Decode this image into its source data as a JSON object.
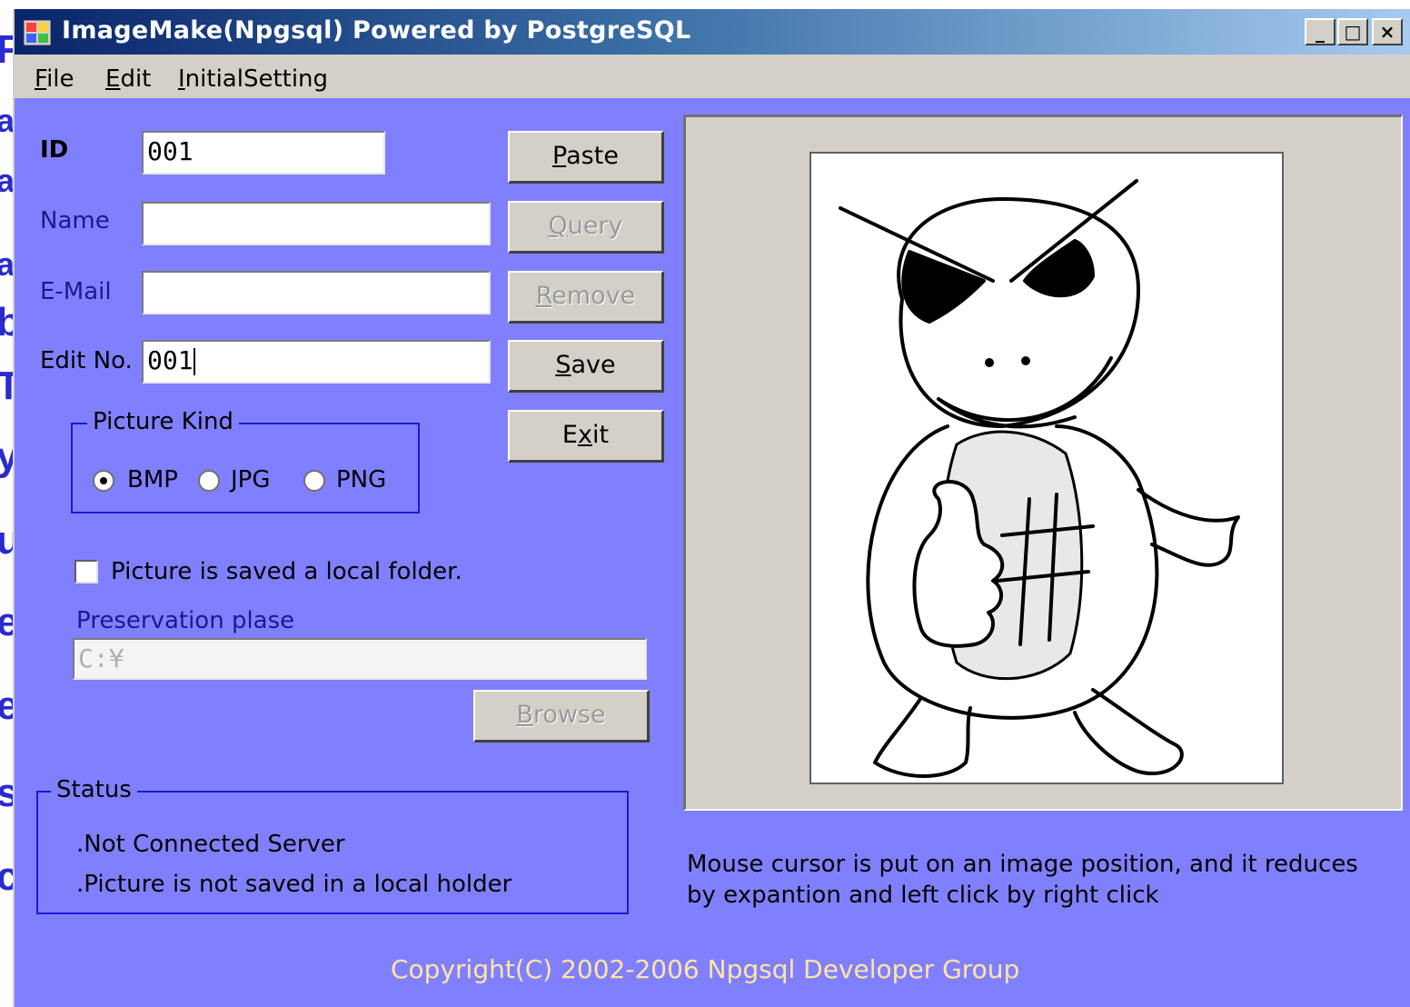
{
  "window": {
    "title": "ImageMake(Npgsql) Powered by PostgreSQL",
    "minimize": "_",
    "maximize": "□",
    "close": "×"
  },
  "background_letters": [
    "F",
    "a",
    "a",
    "a",
    "b",
    "T",
    "y",
    "u",
    "e",
    "e",
    "s",
    "c"
  ],
  "menu": [
    {
      "mnemonic": "F",
      "rest": "ile"
    },
    {
      "mnemonic": "E",
      "rest": "dit"
    },
    {
      "mnemonic": "I",
      "rest": "nitialSetting"
    }
  ],
  "fields": {
    "id_label": "ID",
    "id_value": "001",
    "name_label": "Name",
    "name_value": "",
    "email_label": "E-Mail",
    "email_value": "",
    "editno_label": "Edit No.",
    "editno_value": "001"
  },
  "buttons": {
    "paste": {
      "mnemonic": "P",
      "rest": "aste"
    },
    "query": {
      "mnemonic": "Q",
      "rest": "uery"
    },
    "remove": {
      "mnemonic": "R",
      "rest": "emove"
    },
    "save": {
      "mnemonic": "S",
      "rest": "ave"
    },
    "exit_pre": "E",
    "exit_mnemonic": "x",
    "exit_rest": "it",
    "browse": {
      "mnemonic": "B",
      "rest": "rowse"
    }
  },
  "picture_kind": {
    "title": "Picture Kind",
    "options": [
      "BMP",
      "JPG",
      "PNG"
    ],
    "selected": "BMP"
  },
  "local_save": {
    "label": "Picture is saved a local folder.",
    "checked": false
  },
  "preservation": {
    "label": "Preservation plase",
    "value": "C:¥"
  },
  "status": {
    "title": "Status",
    "lines": [
      ".Not Connected Server",
      ".Picture is not saved in a local holder"
    ]
  },
  "hint": {
    "line1": "Mouse cursor is put on an image position, and it reduces",
    "line2": "by expantion and left click by right click"
  },
  "copyright": "Copyright(C) 2002-2006 Npgsql Developer Group",
  "colors": {
    "form_bg": "#8080ff",
    "title_start": "#0a246a",
    "title_end": "#a6caf0",
    "copyright": "#ffe6a0"
  }
}
